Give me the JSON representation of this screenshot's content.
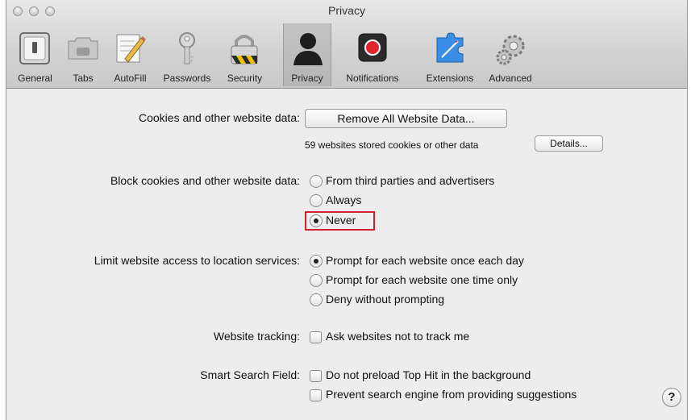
{
  "window": {
    "title": "Privacy"
  },
  "toolbar": {
    "tabs": [
      {
        "label": "General",
        "icon": "switch-icon"
      },
      {
        "label": "Tabs",
        "icon": "tabs-icon"
      },
      {
        "label": "AutoFill",
        "icon": "pencil-form-icon"
      },
      {
        "label": "Passwords",
        "icon": "key-icon"
      },
      {
        "label": "Security",
        "icon": "padlock-icon"
      },
      {
        "label": "Privacy",
        "icon": "person-silhouette-icon"
      },
      {
        "label": "Notifications",
        "icon": "red-record-icon"
      },
      {
        "label": "Extensions",
        "icon": "puzzle-compass-icon"
      },
      {
        "label": "Advanced",
        "icon": "gears-icon"
      }
    ],
    "selected": "Privacy"
  },
  "cookies": {
    "label": "Cookies and other website data:",
    "remove_button": "Remove All Website Data...",
    "stored_text": "59 websites stored cookies or other data",
    "details_button": "Details..."
  },
  "block": {
    "label": "Block cookies and other website data:",
    "options": [
      "From third parties and advertisers",
      "Always",
      "Never"
    ],
    "selected": "Never"
  },
  "location": {
    "label": "Limit website access to location services:",
    "options": [
      "Prompt for each website once each day",
      "Prompt for each website one time only",
      "Deny without prompting"
    ],
    "selected": "Prompt for each website once each day"
  },
  "tracking": {
    "label": "Website tracking:",
    "option": "Ask websites not to track me",
    "checked": false
  },
  "smart_search": {
    "label": "Smart Search Field:",
    "options": [
      "Do not preload Top Hit in the background",
      "Prevent search engine from providing suggestions"
    ],
    "checked": [
      false,
      false
    ]
  },
  "help": {
    "glyph": "?"
  },
  "colors": {
    "highlight": "#d4202c",
    "notification_red": "#e0252c"
  }
}
